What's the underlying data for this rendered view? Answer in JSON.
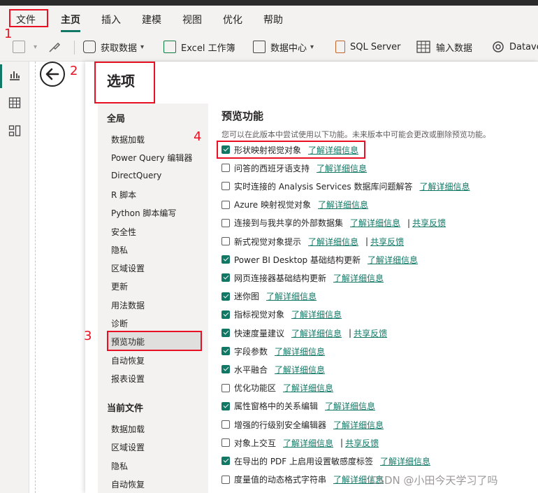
{
  "menubar": {
    "items": [
      "文件",
      "主页",
      "插入",
      "建模",
      "视图",
      "优化",
      "帮助"
    ]
  },
  "ribbon": {
    "get_data": "获取数据",
    "excel": "Excel 工作簿",
    "data_hub": "数据中心",
    "sql_server": "SQL Server",
    "enter_data": "输入数据",
    "dataverse": "Datave"
  },
  "dialog": {
    "title": "选项",
    "global_section": "全局",
    "global_items": [
      "数据加载",
      "Power Query 编辑器",
      "DirectQuery",
      "R 脚本",
      "Python 脚本编写",
      "安全性",
      "隐私",
      "区域设置",
      "更新",
      "用法数据",
      "诊断",
      "预览功能",
      "自动恢复",
      "报表设置"
    ],
    "current_section": "当前文件",
    "current_items": [
      "数据加载",
      "区域设置",
      "隐私",
      "自动恢复"
    ],
    "selected_item": "预览功能",
    "content_title": "预览功能",
    "content_desc": "您可以在此版本中尝试使用以下功能。未来版本中可能会更改或删除预览功能。",
    "learn_more": "了解详细信息",
    "feedback": "共享反馈",
    "features": [
      {
        "label": "形状映射视觉对象",
        "checked": true,
        "feedback": false
      },
      {
        "label": "问答的西班牙语支持",
        "checked": false,
        "feedback": false
      },
      {
        "label": "实时连接的 Analysis Services 数据库问题解答",
        "checked": false,
        "feedback": false
      },
      {
        "label": "Azure 映射视觉对象",
        "checked": false,
        "feedback": false
      },
      {
        "label": "连接到与我共享的外部数据集",
        "checked": false,
        "feedback": true
      },
      {
        "label": "新式视觉对象提示",
        "checked": false,
        "feedback": true
      },
      {
        "label": "Power BI Desktop 基础结构更新",
        "checked": true,
        "feedback": false
      },
      {
        "label": "网页连接器基础结构更新",
        "checked": true,
        "feedback": false
      },
      {
        "label": "迷你图",
        "checked": true,
        "feedback": false
      },
      {
        "label": "指标视觉对象",
        "checked": true,
        "feedback": false
      },
      {
        "label": "快速度量建议",
        "checked": true,
        "feedback": true
      },
      {
        "label": "字段参数",
        "checked": true,
        "feedback": false
      },
      {
        "label": "水平融合",
        "checked": true,
        "feedback": false
      },
      {
        "label": "优化功能区",
        "checked": false,
        "feedback": false
      },
      {
        "label": "属性窗格中的关系编辑",
        "checked": true,
        "feedback": false
      },
      {
        "label": "增强的行级别安全编辑器",
        "checked": false,
        "feedback": false
      },
      {
        "label": "对象上交互",
        "checked": false,
        "feedback": true
      },
      {
        "label": "在导出的 PDF 上启用设置敏感度标签",
        "checked": true,
        "feedback": false
      },
      {
        "label": "度量值的动态格式字符串",
        "checked": false,
        "feedback": false
      }
    ]
  },
  "annotations": [
    "1",
    "2",
    "3",
    "4"
  ],
  "watermark": "CSDN @小田今天学习了吗",
  "colors": {
    "accent": "#117865",
    "annotation": "#e81123"
  }
}
